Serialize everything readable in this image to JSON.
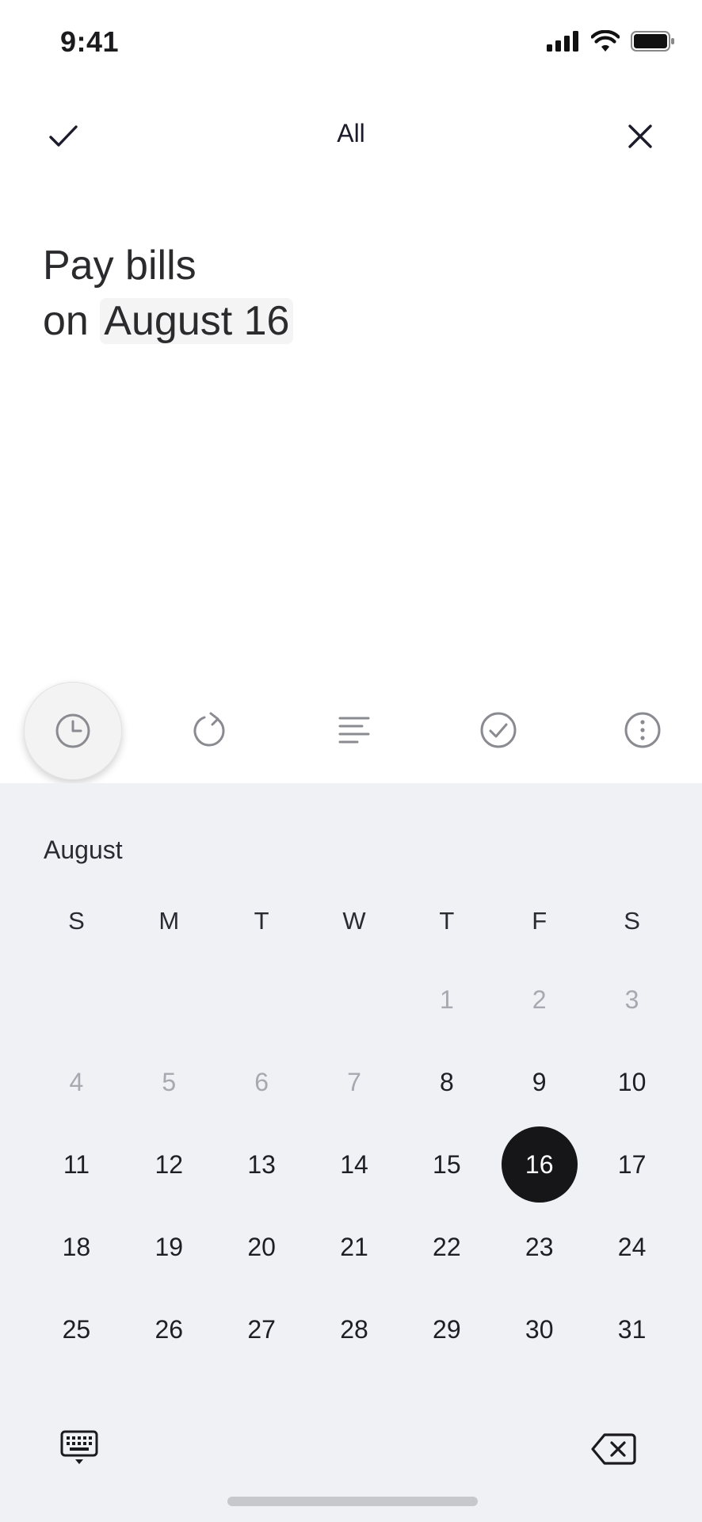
{
  "status_bar": {
    "time": "9:41",
    "icons": [
      "cellular-signal-icon",
      "wifi-icon",
      "battery-icon"
    ]
  },
  "nav": {
    "title": "All",
    "left_icon": "checkmark-icon",
    "right_icon": "close-icon"
  },
  "task": {
    "line1": "Pay bills",
    "prefix": "on",
    "date_token": "August 16"
  },
  "toolbar": {
    "items": [
      "clock-icon",
      "repeat-icon",
      "notes-icon",
      "check-circle-icon",
      "more-icon"
    ],
    "active": "clock-icon"
  },
  "calendar": {
    "month": "August",
    "weekdays": [
      "S",
      "M",
      "T",
      "W",
      "T",
      "F",
      "S"
    ],
    "rows": [
      [
        "",
        "",
        "",
        "",
        "1",
        "2",
        "3"
      ],
      [
        "4",
        "5",
        "6",
        "7",
        "8",
        "9",
        "10"
      ],
      [
        "11",
        "12",
        "13",
        "14",
        "15",
        "16",
        "17"
      ],
      [
        "18",
        "19",
        "20",
        "21",
        "22",
        "23",
        "24"
      ],
      [
        "25",
        "26",
        "27",
        "28",
        "29",
        "30",
        "31"
      ]
    ],
    "disabled_days": [
      "1",
      "2",
      "3",
      "4",
      "5",
      "6",
      "7"
    ],
    "selected_day": "16"
  },
  "bottom": {
    "left_icon": "keyboard-icon",
    "right_icon": "delete-backspace-icon"
  },
  "colors": {
    "selected": "#161618",
    "panel": "#f0f1f5",
    "dim": "#a8a9b0"
  }
}
